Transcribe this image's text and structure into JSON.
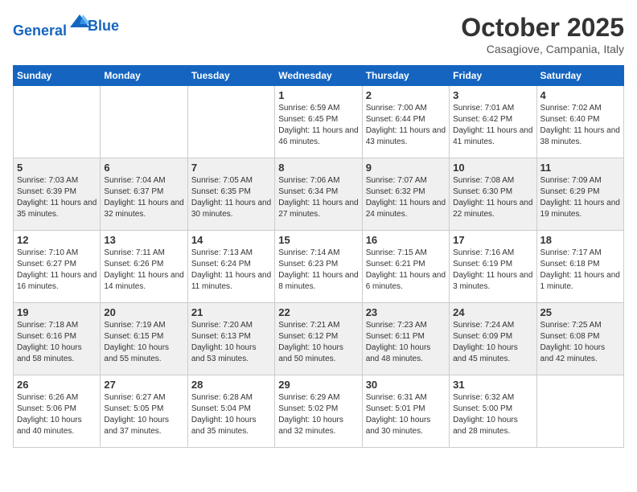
{
  "header": {
    "logo_line1": "General",
    "logo_line2": "Blue",
    "month": "October 2025",
    "location": "Casagiove, Campania, Italy"
  },
  "weekdays": [
    "Sunday",
    "Monday",
    "Tuesday",
    "Wednesday",
    "Thursday",
    "Friday",
    "Saturday"
  ],
  "weeks": [
    [
      {
        "day": "",
        "info": ""
      },
      {
        "day": "",
        "info": ""
      },
      {
        "day": "",
        "info": ""
      },
      {
        "day": "1",
        "info": "Sunrise: 6:59 AM\nSunset: 6:45 PM\nDaylight: 11 hours and 46 minutes."
      },
      {
        "day": "2",
        "info": "Sunrise: 7:00 AM\nSunset: 6:44 PM\nDaylight: 11 hours and 43 minutes."
      },
      {
        "day": "3",
        "info": "Sunrise: 7:01 AM\nSunset: 6:42 PM\nDaylight: 11 hours and 41 minutes."
      },
      {
        "day": "4",
        "info": "Sunrise: 7:02 AM\nSunset: 6:40 PM\nDaylight: 11 hours and 38 minutes."
      }
    ],
    [
      {
        "day": "5",
        "info": "Sunrise: 7:03 AM\nSunset: 6:39 PM\nDaylight: 11 hours and 35 minutes."
      },
      {
        "day": "6",
        "info": "Sunrise: 7:04 AM\nSunset: 6:37 PM\nDaylight: 11 hours and 32 minutes."
      },
      {
        "day": "7",
        "info": "Sunrise: 7:05 AM\nSunset: 6:35 PM\nDaylight: 11 hours and 30 minutes."
      },
      {
        "day": "8",
        "info": "Sunrise: 7:06 AM\nSunset: 6:34 PM\nDaylight: 11 hours and 27 minutes."
      },
      {
        "day": "9",
        "info": "Sunrise: 7:07 AM\nSunset: 6:32 PM\nDaylight: 11 hours and 24 minutes."
      },
      {
        "day": "10",
        "info": "Sunrise: 7:08 AM\nSunset: 6:30 PM\nDaylight: 11 hours and 22 minutes."
      },
      {
        "day": "11",
        "info": "Sunrise: 7:09 AM\nSunset: 6:29 PM\nDaylight: 11 hours and 19 minutes."
      }
    ],
    [
      {
        "day": "12",
        "info": "Sunrise: 7:10 AM\nSunset: 6:27 PM\nDaylight: 11 hours and 16 minutes."
      },
      {
        "day": "13",
        "info": "Sunrise: 7:11 AM\nSunset: 6:26 PM\nDaylight: 11 hours and 14 minutes."
      },
      {
        "day": "14",
        "info": "Sunrise: 7:13 AM\nSunset: 6:24 PM\nDaylight: 11 hours and 11 minutes."
      },
      {
        "day": "15",
        "info": "Sunrise: 7:14 AM\nSunset: 6:23 PM\nDaylight: 11 hours and 8 minutes."
      },
      {
        "day": "16",
        "info": "Sunrise: 7:15 AM\nSunset: 6:21 PM\nDaylight: 11 hours and 6 minutes."
      },
      {
        "day": "17",
        "info": "Sunrise: 7:16 AM\nSunset: 6:19 PM\nDaylight: 11 hours and 3 minutes."
      },
      {
        "day": "18",
        "info": "Sunrise: 7:17 AM\nSunset: 6:18 PM\nDaylight: 11 hours and 1 minute."
      }
    ],
    [
      {
        "day": "19",
        "info": "Sunrise: 7:18 AM\nSunset: 6:16 PM\nDaylight: 10 hours and 58 minutes."
      },
      {
        "day": "20",
        "info": "Sunrise: 7:19 AM\nSunset: 6:15 PM\nDaylight: 10 hours and 55 minutes."
      },
      {
        "day": "21",
        "info": "Sunrise: 7:20 AM\nSunset: 6:13 PM\nDaylight: 10 hours and 53 minutes."
      },
      {
        "day": "22",
        "info": "Sunrise: 7:21 AM\nSunset: 6:12 PM\nDaylight: 10 hours and 50 minutes."
      },
      {
        "day": "23",
        "info": "Sunrise: 7:23 AM\nSunset: 6:11 PM\nDaylight: 10 hours and 48 minutes."
      },
      {
        "day": "24",
        "info": "Sunrise: 7:24 AM\nSunset: 6:09 PM\nDaylight: 10 hours and 45 minutes."
      },
      {
        "day": "25",
        "info": "Sunrise: 7:25 AM\nSunset: 6:08 PM\nDaylight: 10 hours and 42 minutes."
      }
    ],
    [
      {
        "day": "26",
        "info": "Sunrise: 6:26 AM\nSunset: 5:06 PM\nDaylight: 10 hours and 40 minutes."
      },
      {
        "day": "27",
        "info": "Sunrise: 6:27 AM\nSunset: 5:05 PM\nDaylight: 10 hours and 37 minutes."
      },
      {
        "day": "28",
        "info": "Sunrise: 6:28 AM\nSunset: 5:04 PM\nDaylight: 10 hours and 35 minutes."
      },
      {
        "day": "29",
        "info": "Sunrise: 6:29 AM\nSunset: 5:02 PM\nDaylight: 10 hours and 32 minutes."
      },
      {
        "day": "30",
        "info": "Sunrise: 6:31 AM\nSunset: 5:01 PM\nDaylight: 10 hours and 30 minutes."
      },
      {
        "day": "31",
        "info": "Sunrise: 6:32 AM\nSunset: 5:00 PM\nDaylight: 10 hours and 28 minutes."
      },
      {
        "day": "",
        "info": ""
      }
    ]
  ]
}
